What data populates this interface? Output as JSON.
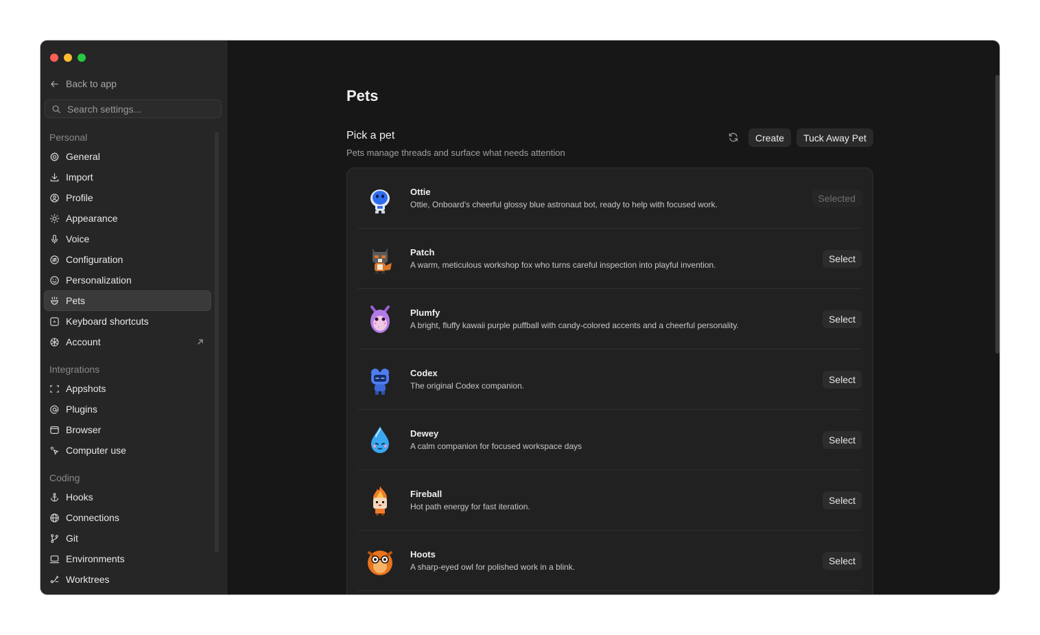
{
  "sidebar": {
    "back_label": "Back to app",
    "search_placeholder": "Search settings...",
    "groups": [
      {
        "label": "Personal",
        "items": [
          {
            "label": "General",
            "icon": "gear-icon"
          },
          {
            "label": "Import",
            "icon": "download-icon"
          },
          {
            "label": "Profile",
            "icon": "user-circle-icon"
          },
          {
            "label": "Appearance",
            "icon": "sun-icon"
          },
          {
            "label": "Voice",
            "icon": "microphone-icon"
          },
          {
            "label": "Configuration",
            "icon": "sliders-icon"
          },
          {
            "label": "Personalization",
            "icon": "smile-icon"
          },
          {
            "label": "Pets",
            "icon": "paw-icon"
          },
          {
            "label": "Keyboard shortcuts",
            "icon": "keyboard-icon"
          },
          {
            "label": "Account",
            "icon": "openai-icon"
          }
        ]
      },
      {
        "label": "Integrations",
        "items": [
          {
            "label": "Appshots",
            "icon": "screenshot-icon"
          },
          {
            "label": "Plugins",
            "icon": "at-icon"
          },
          {
            "label": "Browser",
            "icon": "browser-icon"
          },
          {
            "label": "Computer use",
            "icon": "sparkle-cursor-icon"
          }
        ]
      },
      {
        "label": "Coding",
        "items": [
          {
            "label": "Hooks",
            "icon": "anchor-icon"
          },
          {
            "label": "Connections",
            "icon": "globe-icon"
          },
          {
            "label": "Git",
            "icon": "git-branch-icon"
          },
          {
            "label": "Environments",
            "icon": "laptop-icon"
          },
          {
            "label": "Worktrees",
            "icon": "worktree-icon"
          }
        ]
      }
    ],
    "active_item": "Pets"
  },
  "main": {
    "page_title": "Pets",
    "section_title": "Pick a pet",
    "section_subtitle": "Pets manage threads and surface what needs attention",
    "create_label": "Create",
    "tuck_label": "Tuck Away Pet",
    "pets": [
      {
        "name": "Ottie",
        "desc": "Ottie, Onboard's cheerful glossy blue astronaut bot, ready to help with focused work.",
        "action": "Selected",
        "selected": true,
        "color": "#2f6df0"
      },
      {
        "name": "Patch",
        "desc": "A warm, meticulous workshop fox who turns careful inspection into playful invention.",
        "action": "Select",
        "selected": false,
        "color": "#d9772b"
      },
      {
        "name": "Plumfy",
        "desc": "A bright, fluffy kawaii purple puffball with candy-colored accents and a cheerful personality.",
        "action": "Select",
        "selected": false,
        "color": "#b27ce6"
      },
      {
        "name": "Codex",
        "desc": "The original Codex companion.",
        "action": "Select",
        "selected": false,
        "color": "#4f7df0"
      },
      {
        "name": "Dewey",
        "desc": "A calm companion for focused workspace days",
        "action": "Select",
        "selected": false,
        "color": "#3aa8f0"
      },
      {
        "name": "Fireball",
        "desc": "Hot path energy for fast iteration.",
        "action": "Select",
        "selected": false,
        "color": "#f07a2a"
      },
      {
        "name": "Hoots",
        "desc": "A sharp-eyed owl for polished work in a blink.",
        "action": "Select",
        "selected": false,
        "color": "#e8741e"
      }
    ]
  }
}
